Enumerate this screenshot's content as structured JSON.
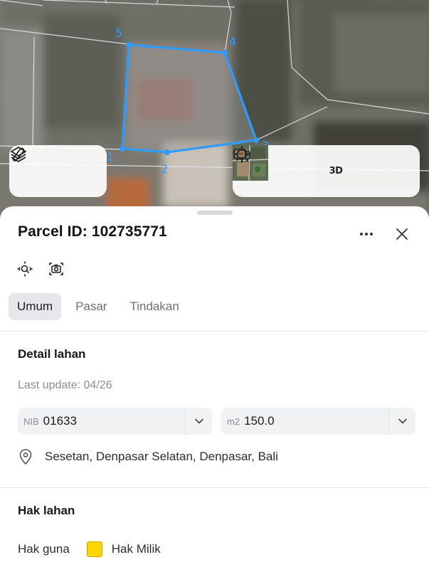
{
  "map": {
    "vertex_labels": [
      "1",
      "2",
      "3",
      "4",
      "5"
    ],
    "colors": {
      "parcel_outline": "#2f9bff"
    },
    "left_controls": [
      {
        "icon": "layers-icon"
      },
      {
        "icon": "draw-path-icon"
      }
    ],
    "right_controls": [
      {
        "icon": "satellite-thumbnail"
      },
      {
        "icon": "crosshair-locate-icon"
      },
      {
        "icon": "3d-view-icon",
        "label": "3D"
      },
      {
        "icon": "chat-feedback-icon"
      }
    ]
  },
  "sheet": {
    "title": "Parcel ID: 102735771",
    "tabs": [
      {
        "label": "Umum",
        "active": true
      },
      {
        "label": "Pasar",
        "active": false
      },
      {
        "label": "Tindakan",
        "active": false
      }
    ],
    "detail": {
      "heading": "Detail lahan",
      "last_update": "Last update: 04/26",
      "nib": {
        "prefix": "NIB",
        "value": "01633"
      },
      "area": {
        "prefix": "m2",
        "value": "150.0"
      },
      "location": "Sesetan, Denpasar Selatan, Denpasar, Bali"
    },
    "rights": {
      "heading": "Hak lahan",
      "label": "Hak guna",
      "value": "Hak Milik",
      "swatch_color": "#ffd600"
    }
  }
}
